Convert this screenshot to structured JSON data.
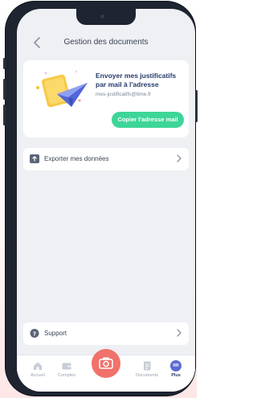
{
  "header": {
    "back_icon": "chevron-left-icon",
    "title": "Gestion des documents"
  },
  "mail_card": {
    "title": "Envoyer mes justificatifs par mail à l'adresse",
    "email": "mes-justificatifs@time.fr",
    "copy_button": "Copier l'adresse mail",
    "accent_color": "#3dd598"
  },
  "rows": [
    {
      "label": "Exporter mes données",
      "icon": "export-icon"
    },
    {
      "label": "Support",
      "icon": "help-icon"
    }
  ],
  "tabbar": {
    "tabs": [
      {
        "label": "Accueil",
        "icon": "home-icon"
      },
      {
        "label": "Comptes",
        "icon": "wallet-icon"
      },
      {
        "label": "",
        "icon": "camera-icon"
      },
      {
        "label": "Documents",
        "icon": "document-icon"
      },
      {
        "label": "Plus",
        "icon": "avatar-icon",
        "avatar_text": "RR"
      }
    ],
    "camera_color": "#f0726b"
  }
}
